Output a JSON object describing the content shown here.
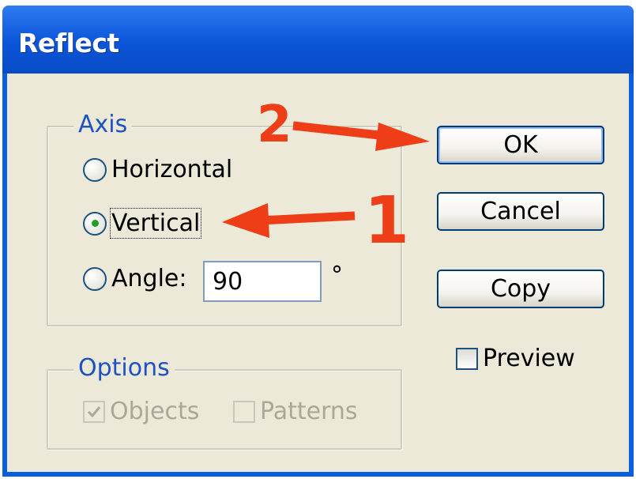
{
  "window": {
    "title": "Reflect"
  },
  "axis_group": {
    "legend": "Axis",
    "horizontal_label": "Horizontal",
    "vertical_label": "Vertical",
    "angle_label": "Angle:",
    "angle_value": "90",
    "degree_symbol": "°",
    "selected": "Vertical"
  },
  "options_group": {
    "legend": "Options",
    "objects_label": "Objects",
    "objects_checked": true,
    "patterns_label": "Patterns",
    "patterns_checked": false
  },
  "buttons": {
    "ok": "OK",
    "cancel": "Cancel",
    "copy": "Copy"
  },
  "preview": {
    "label": "Preview",
    "checked": false
  },
  "annotations": {
    "arrow_1_label": "1",
    "arrow_2_label": "2",
    "color": "#ee3e18"
  },
  "colors": {
    "titlebar": "#0a55d8",
    "dialog_bg": "#ece9d8",
    "group_label": "#1c52c6",
    "disabled_text": "#aca899"
  }
}
